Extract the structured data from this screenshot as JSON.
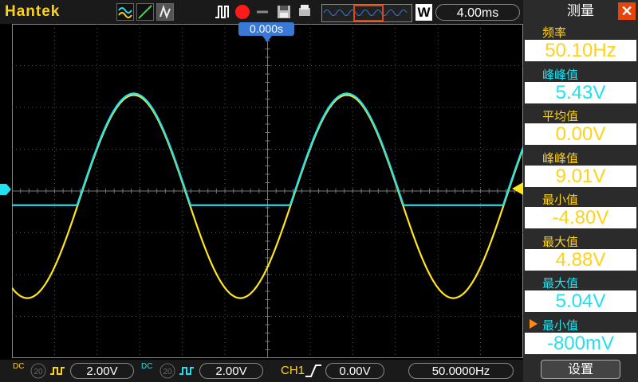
{
  "brand": "Hantek",
  "topbar": {
    "timebase": "4.00ms",
    "acq_mode": "W",
    "trigger_pos": "0.000s"
  },
  "right_panel": {
    "title": "测量",
    "close_icon": "close-icon",
    "measurements": [
      {
        "label": "频率",
        "value": "50.10Hz",
        "color": "#ffd21a"
      },
      {
        "label": "峰峰值",
        "value": "5.43V",
        "color": "#22e0ee"
      },
      {
        "label": "平均值",
        "value": "0.00V",
        "color": "#ffd21a"
      },
      {
        "label": "峰峰值",
        "value": "9.01V",
        "color": "#ffd21a"
      },
      {
        "label": "最小值",
        "value": "-4.80V",
        "color": "#ffd21a"
      },
      {
        "label": "最大值",
        "value": "4.88V",
        "color": "#ffd21a"
      },
      {
        "label": "最大值",
        "value": "5.04V",
        "color": "#22e0ee"
      },
      {
        "label": "最小值",
        "value": "-800mV",
        "color": "#22e0ee"
      }
    ],
    "settings_label": "设置"
  },
  "bottombar": {
    "ch1_scale": "2.00V",
    "ch2_scale": "2.00V",
    "trigger_source": "CH1",
    "trigger_level": "0.00V",
    "trigger_freq": "50.0000Hz",
    "coupling_label": "DC",
    "bw_label": "20"
  },
  "colors": {
    "ch1": "#ffe51a",
    "ch2": "#22e0ee"
  }
}
